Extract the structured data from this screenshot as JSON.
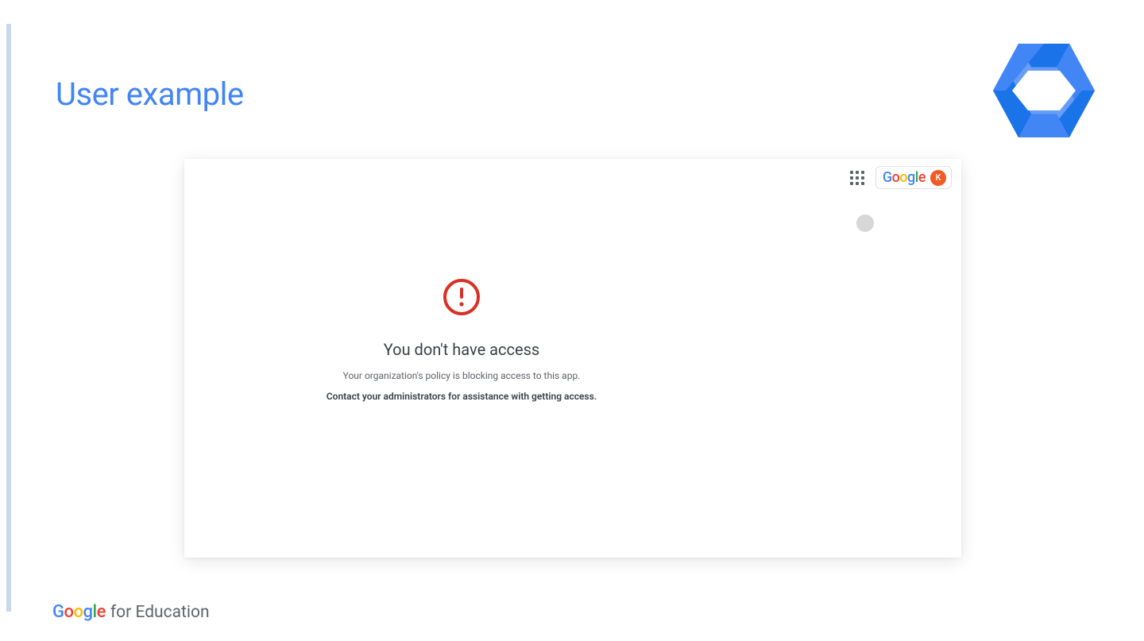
{
  "slide": {
    "title": "User example"
  },
  "topbar": {
    "avatar_initial": "K"
  },
  "error": {
    "title": "You don't have access",
    "subtitle": "Your organization's policy is blocking access to this app.",
    "action": "Contact your administrators for assistance with getting access."
  },
  "footer": {
    "suffix": "for Education"
  }
}
